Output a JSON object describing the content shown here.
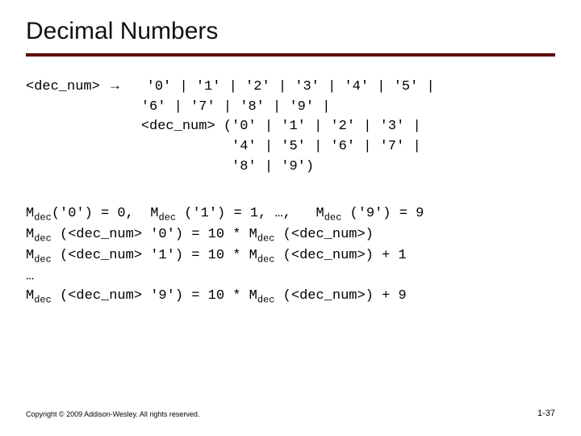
{
  "title": "Decimal Numbers",
  "grammar": {
    "lhs": "<dec_num>",
    "arrow": "→",
    "l1": "'0' | '1' | '2' | '3' | '4' | '5' |",
    "l2": "'6' | '7' | '8' | '9' |",
    "l3": "<dec_num> ('0' | '1' | '2' | '3' |",
    "l4": "           '4' | '5' | '6' | '7' |",
    "l5": "           '8' | '9')"
  },
  "sem": {
    "m": "M",
    "sub": "dec",
    "r1a": "('0') = 0,  ",
    "r1b": " ('1') = 1, …,   ",
    "r1c": " ('9') = 9",
    "r2a": " (<dec_num> '0') = 10 * ",
    "r2b": " (<dec_num>)",
    "r3a": " (<dec_num> '1') = 10 * ",
    "r3b": " (<dec_num>) + 1",
    "ell": "…",
    "r4a": " (<dec_num> '9') = 10 * ",
    "r4b": " (<dec_num>) + 9"
  },
  "footer": {
    "copyright": "Copyright © 2009 Addison-Wesley. All rights reserved.",
    "page": "1-37"
  }
}
